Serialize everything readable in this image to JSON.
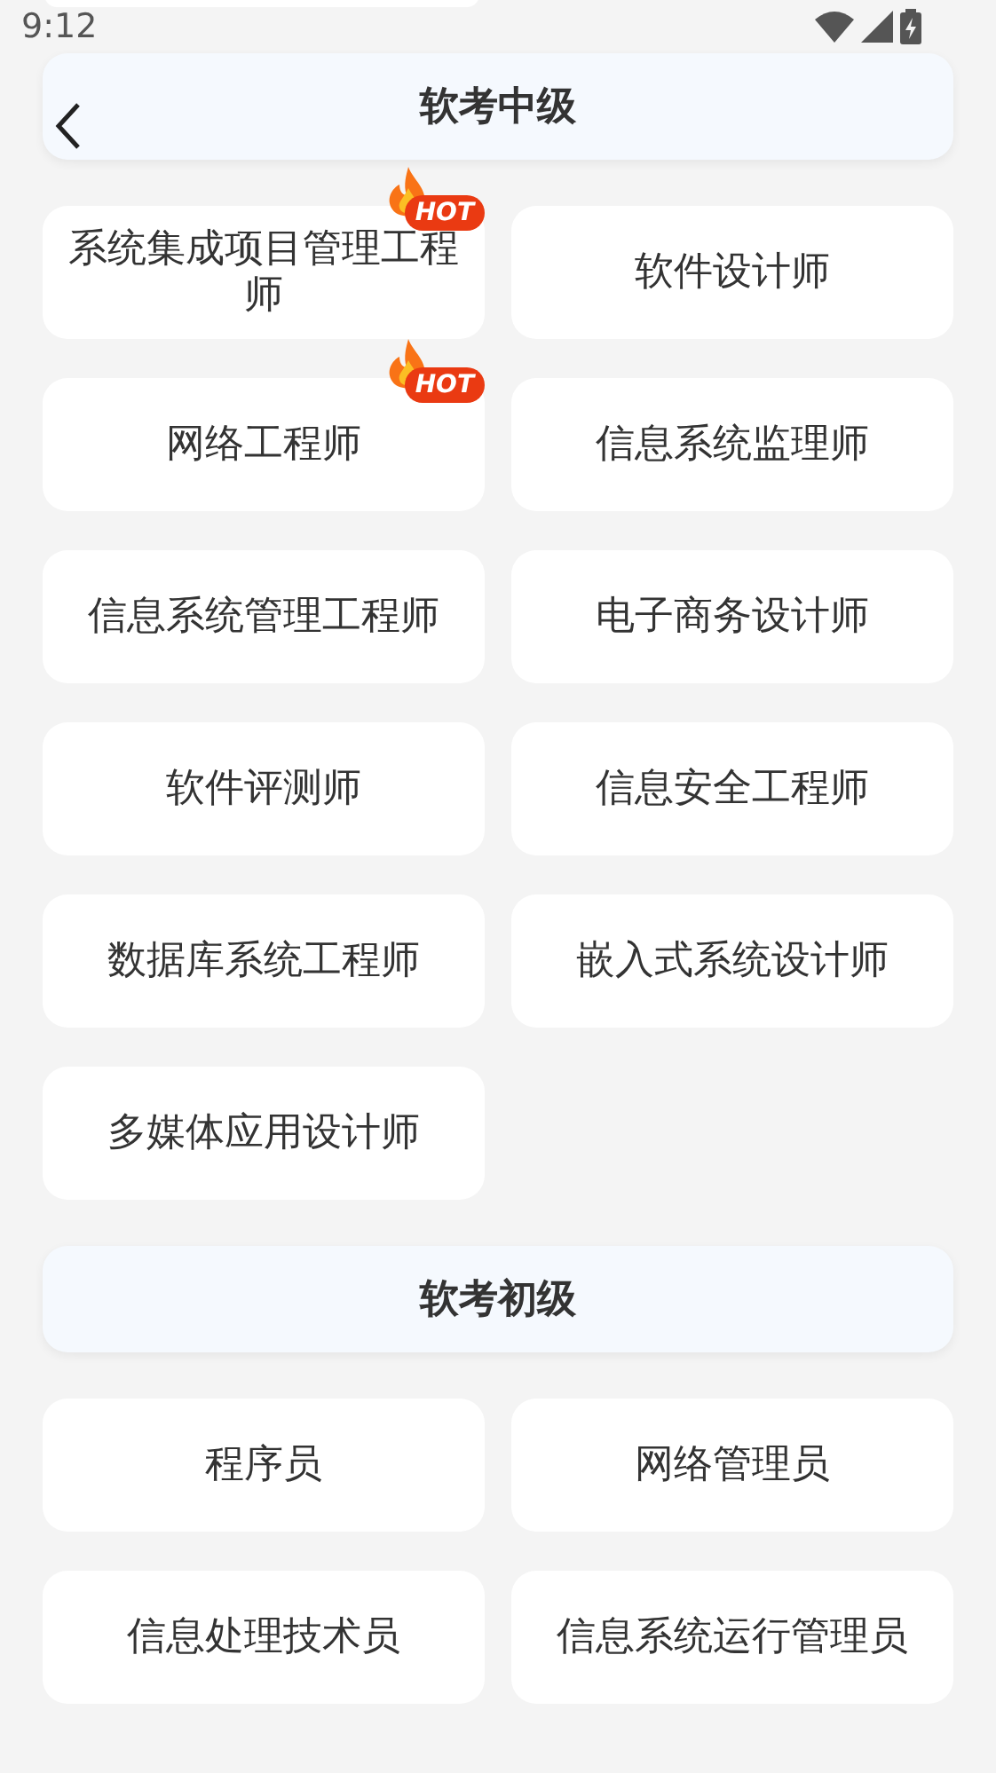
{
  "status_bar": {
    "time": "9:12"
  },
  "sections": [
    {
      "title": "软考中级",
      "back": true,
      "items": [
        {
          "label": "系统集成项目管理工程师",
          "badge": "HOT"
        },
        {
          "label": "软件设计师"
        },
        {
          "label": "网络工程师",
          "badge": "HOT"
        },
        {
          "label": "信息系统监理师"
        },
        {
          "label": "信息系统管理工程师"
        },
        {
          "label": "电子商务设计师"
        },
        {
          "label": "软件评测师"
        },
        {
          "label": "信息安全工程师"
        },
        {
          "label": "数据库系统工程师"
        },
        {
          "label": "嵌入式系统设计师"
        },
        {
          "label": "多媒体应用设计师"
        }
      ]
    },
    {
      "title": "软考初级",
      "back": false,
      "items": [
        {
          "label": "程序员"
        },
        {
          "label": "网络管理员"
        },
        {
          "label": "信息处理技术员"
        },
        {
          "label": "信息系统运行管理员"
        }
      ]
    }
  ]
}
